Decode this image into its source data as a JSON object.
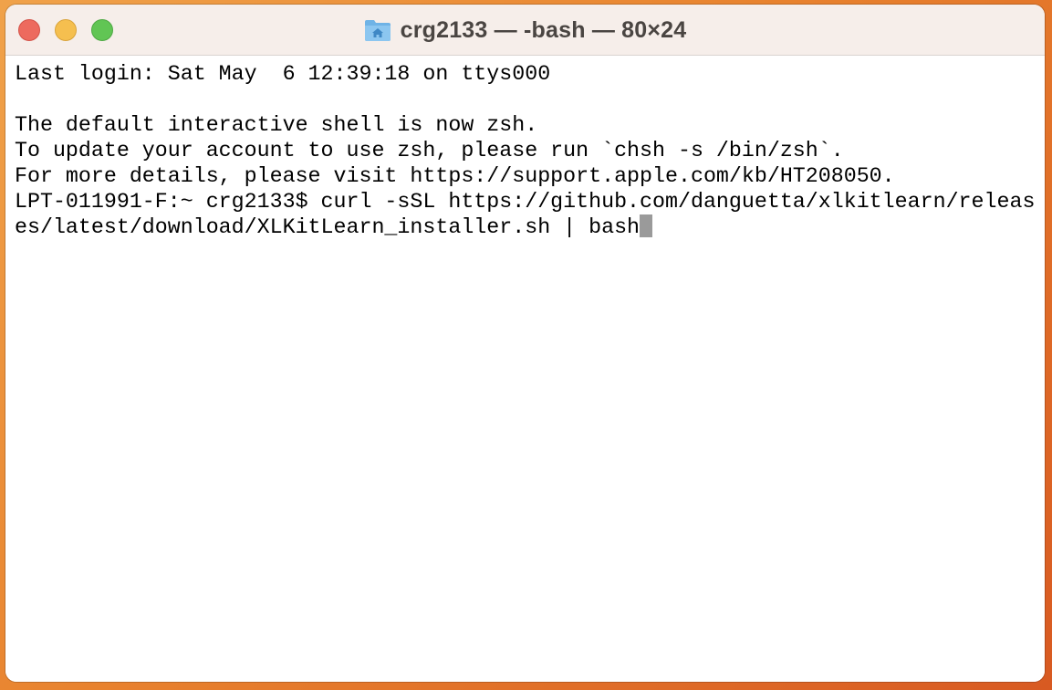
{
  "window": {
    "title": "crg2133 — -bash — 80×24",
    "title_icon": "home-folder-icon"
  },
  "terminal": {
    "lines": [
      "Last login: Sat May  6 12:39:18 on ttys000",
      "",
      "The default interactive shell is now zsh.",
      "To update your account to use zsh, please run `chsh -s /bin/zsh`.",
      "For more details, please visit https://support.apple.com/kb/HT208050.",
      "LPT-011991-F:~ crg2133$ curl -sSL https://github.com/danguetta/xlkitlearn/releas",
      "es/latest/download/XLKitLearn_installer.sh | bash"
    ]
  },
  "colors": {
    "close": "#ed6a5e",
    "minimize": "#f5bf4f",
    "zoom": "#61c554",
    "cursor": "#9a9a9a"
  }
}
